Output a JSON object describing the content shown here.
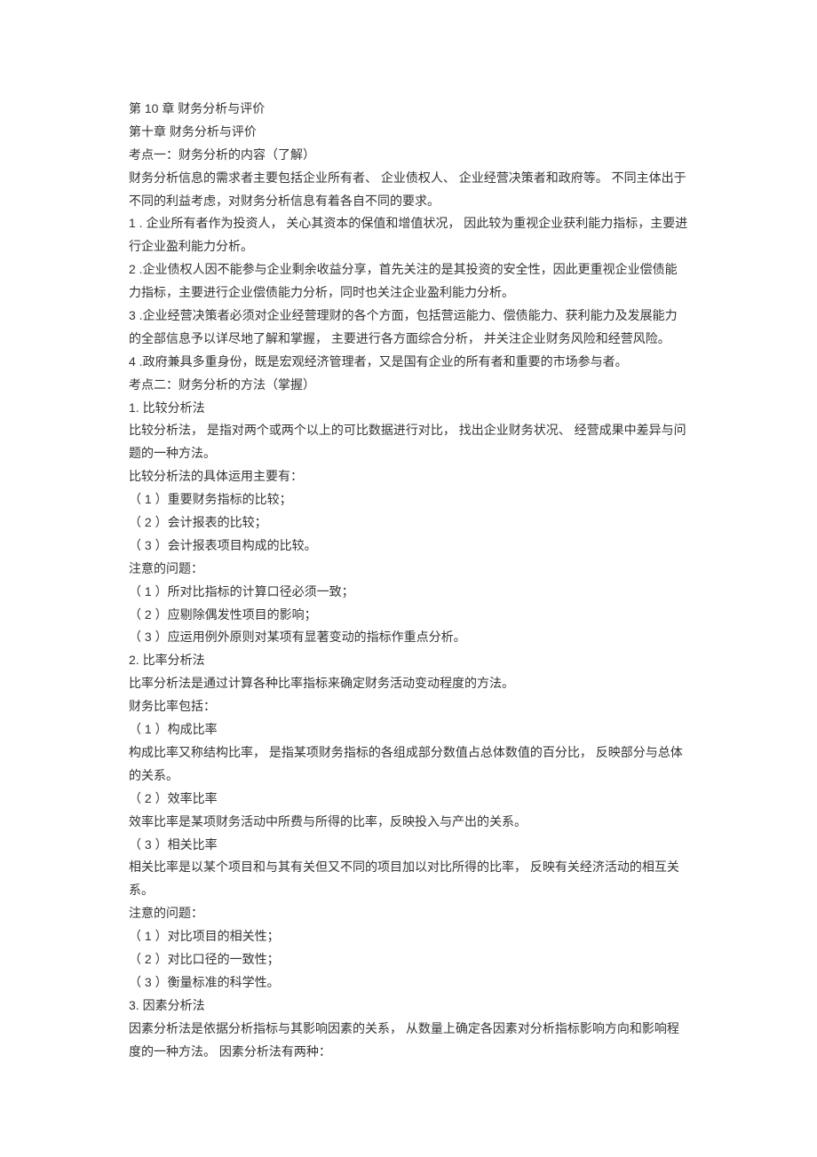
{
  "lines": [
    "第 10 章 财务分析与评价",
    "第十章 财务分析与评价",
    "考点一：财务分析的内容（了解）",
    "财务分析信息的需求者主要包括企业所有者、 企业债权人、 企业经营决策者和政府等。 不同主体出于不同的利益考虑，对财务分析信息有着各自不同的要求。",
    "1 . 企业所有者作为投资人， 关心其资本的保值和增值状况， 因此较为重视企业获利能力指标，主要进行企业盈利能力分析。",
    "2 .企业债权人因不能参与企业剩余收益分享，首先关注的是其投资的安全性，因此更重视企业偿债能力指标，主要进行企业偿债能力分析，同时也关注企业盈利能力分析。",
    "3 .企业经营决策者必须对企业经营理财的各个方面，包括营运能力、偿债能力、获利能力及发展能力的全部信息予以详尽地了解和掌握， 主要进行各方面综合分析， 并关注企业财务风险和经营风险。",
    "4 .政府兼具多重身份，既是宏观经济管理者，又是国有企业的所有者和重要的市场参与者。",
    "考点二：财务分析的方法（掌握）",
    "1. 比较分析法",
    "比较分析法， 是指对两个或两个以上的可比数据进行对比， 找出企业财务状况、 经营成果中差异与问题的一种方法。",
    "比较分析法的具体运用主要有：",
    "（ 1 ）重要财务指标的比较；",
    "（ 2 ）会计报表的比较；",
    "（ 3 ）会计报表项目构成的比较。",
    "注意的问题：",
    "（ 1 ）所对比指标的计算口径必须一致；",
    "（ 2 ）应剔除偶发性项目的影响；",
    "（ 3 ）应运用例外原则对某项有显著变动的指标作重点分析。",
    "2. 比率分析法",
    "比率分析法是通过计算各种比率指标来确定财务活动变动程度的方法。",
    "财务比率包括：",
    "（ 1 ）构成比率",
    "构成比率又称结构比率， 是指某项财务指标的各组成部分数值占总体数值的百分比， 反映部分与总体的关系。",
    "（ 2 ）效率比率",
    "效率比率是某项财务活动中所费与所得的比率，反映投入与产出的关系。",
    "（ 3 ）相关比率",
    "相关比率是以某个项目和与其有关但又不同的项目加以对比所得的比率， 反映有关经济活动的相互关系。",
    "注意的问题：",
    "（ 1 ）对比项目的相关性；",
    "（ 2 ）对比口径的一致性；",
    "（ 3 ）衡量标准的科学性。",
    "3. 因素分析法",
    "因素分析法是依据分析指标与其影响因素的关系， 从数量上确定各因素对分析指标影响方向和影响程度的一种方法。 因素分析法有两种："
  ]
}
